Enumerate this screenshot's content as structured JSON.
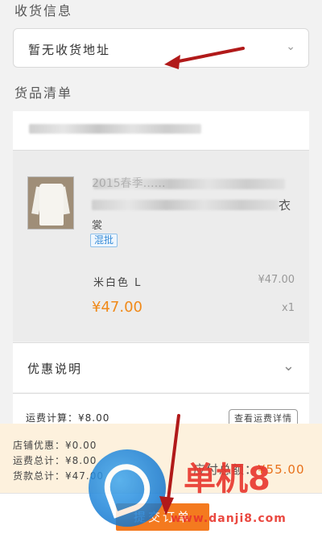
{
  "shipping": {
    "section_title": "收货信息",
    "address_placeholder": "暂无收货地址"
  },
  "goods": {
    "section_title": "货品清单",
    "item": {
      "title_line1": "2015春季……",
      "title_line2_end": "衣",
      "title_line3": "裳",
      "tag": "混批",
      "spec": "米白色 L",
      "unit_price": "¥47.00",
      "price": "¥47.00",
      "quantity": "x1"
    }
  },
  "discount": {
    "label": "优惠说明"
  },
  "shipping_fee": {
    "label": "运费计算：¥8.00",
    "detail_button": "查看运费详情"
  },
  "summary": {
    "shop_discount": "店铺优惠：¥0.00",
    "shipping_total": "运费总计：¥8.00",
    "goods_total": "货款总计：¥47.00",
    "total_label": "应付总额：",
    "total_value": "¥55.00"
  },
  "footer": {
    "submit_label": "提交订单"
  },
  "watermark": {
    "name": "单机8",
    "url": "www.danji8.com"
  },
  "colors": {
    "accent": "#f47a1f",
    "arrow": "#b11a1a",
    "tag_blue": "#3a8dd8"
  }
}
